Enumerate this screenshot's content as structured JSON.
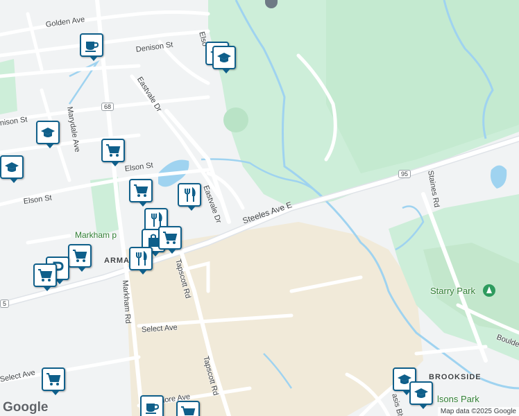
{
  "map": {
    "attribution": "Map data ©2025 Google",
    "logo": "Google",
    "colors": {
      "land": "#f1f3f4",
      "park": "#cdeed9",
      "industrial": "#f1ead9",
      "water": "#9fd3f0",
      "road": "#ffffff",
      "major_road": "#dfe3e8",
      "poi_border": "#0f5f8a"
    }
  },
  "streets": {
    "golden_ave": "Golden Ave",
    "denison_st": "Denison St",
    "elson_top": "Elso",
    "eastvale_dr_upper": "Eastvale Dr",
    "marydale_ave": "Marydale Ave",
    "denison_left": "nison St",
    "elson_st_1": "Elson St",
    "elson_st_2": "Elson St",
    "eastvale_dr_lower": "Eastvale Dr",
    "steeles_ave_e": "Steeles Ave E",
    "staines_rd": "Staines Rd",
    "markham_rd": "Markham Rd",
    "tapscott_rd_upper": "Tapscott Rd",
    "tapscott_rd_lower": "Tapscott Rd",
    "select_ave_1": "Select Ave",
    "select_ave_2": "Select Ave",
    "passmore_ave": "Passmore Ave",
    "oasis_blvd": "asis Blvd",
    "boulder": "Boulde"
  },
  "areas": {
    "markham_park": "Markham p",
    "armadale": "ARMA",
    "starry_park": "Starry Park",
    "brookside": "BROOKSIDE",
    "parsons_park": "lsons Park"
  },
  "route_shields": {
    "r68": "68",
    "r95": "95",
    "r5": "5"
  },
  "pois": [
    {
      "type": "cafe",
      "icon": "coffee-cup-icon"
    },
    {
      "type": "school",
      "icon": "graduation-cap-icon"
    },
    {
      "type": "school",
      "icon": "graduation-cap-icon"
    },
    {
      "type": "school",
      "icon": "graduation-cap-icon"
    },
    {
      "type": "grocery",
      "icon": "shopping-cart-icon"
    },
    {
      "type": "grocery",
      "icon": "shopping-cart-icon"
    },
    {
      "type": "restaurant",
      "icon": "fork-knife-icon"
    },
    {
      "type": "restaurant",
      "icon": "fork-knife-icon"
    },
    {
      "type": "shopping",
      "icon": "shopping-bag-icon"
    },
    {
      "type": "grocery",
      "icon": "shopping-cart-icon"
    },
    {
      "type": "restaurant",
      "icon": "fork-knife-icon"
    },
    {
      "type": "grocery",
      "icon": "shopping-cart-icon"
    },
    {
      "type": "parking",
      "icon": "parking-icon"
    },
    {
      "type": "grocery",
      "icon": "shopping-cart-icon"
    },
    {
      "type": "grocery",
      "icon": "shopping-cart-icon"
    },
    {
      "type": "cafe",
      "icon": "coffee-cup-icon"
    },
    {
      "type": "grocery",
      "icon": "shopping-cart-icon"
    },
    {
      "type": "school",
      "icon": "graduation-cap-icon"
    },
    {
      "type": "school",
      "icon": "graduation-cap-icon"
    }
  ]
}
